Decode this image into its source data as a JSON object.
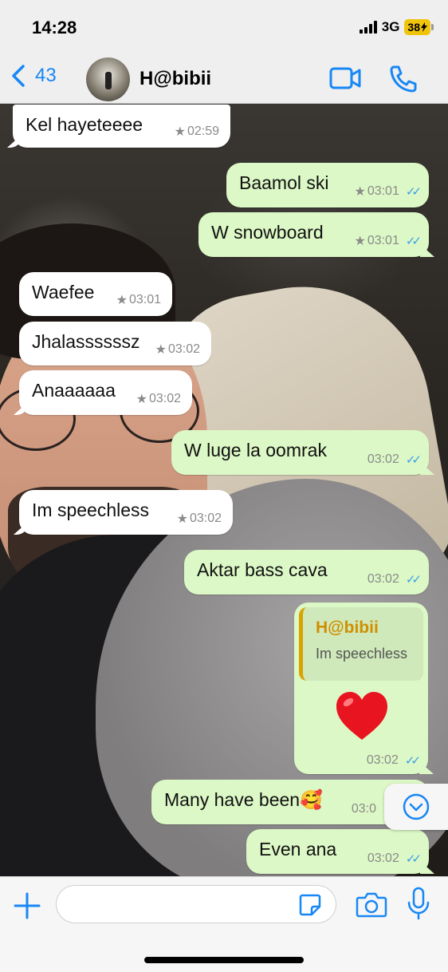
{
  "status_bar": {
    "time": "14:28",
    "network": "3G",
    "battery": "38"
  },
  "header": {
    "back_count": "43",
    "contact_name": "H@bibii",
    "icons": [
      "back-chevron-icon",
      "video-call-icon",
      "phone-call-icon"
    ]
  },
  "messages": [
    {
      "dir": "in",
      "text": "Kel hayeteeee",
      "time": "02:59",
      "starred": true
    },
    {
      "dir": "out",
      "text": "Baamol ski",
      "time": "03:01",
      "starred": true,
      "read": true
    },
    {
      "dir": "out",
      "text": "W snowboard",
      "time": "03:01",
      "starred": true,
      "read": true
    },
    {
      "dir": "in",
      "text": "Waefee",
      "time": "03:01",
      "starred": true
    },
    {
      "dir": "in",
      "text": "Jhalassssssz",
      "time": "03:02",
      "starred": true
    },
    {
      "dir": "in",
      "text": "Anaaaaaa",
      "time": "03:02",
      "starred": true
    },
    {
      "dir": "out",
      "text": "W luge la oomrak",
      "time": "03:02",
      "read": true
    },
    {
      "dir": "in",
      "text": "Im speechless",
      "time": "03:02",
      "starred": true
    },
    {
      "dir": "out",
      "text": "Aktar bass cava",
      "time": "03:02",
      "read": true
    },
    {
      "dir": "out",
      "type": "reply",
      "quote_name": "H@bibii",
      "quote_text": "Im speechless",
      "text": "❤️",
      "time": "03:02",
      "read": true
    },
    {
      "dir": "out",
      "text": "Many have been🥰",
      "time": "03:0",
      "read": true
    },
    {
      "dir": "out",
      "text": "Even ana",
      "time": "03:02",
      "read": true
    }
  ],
  "star_glyph": "★",
  "ticks_glyph": "✓✓",
  "input": {
    "placeholder": "",
    "value": ""
  },
  "colors": {
    "accent": "#1787f5",
    "outgoing_bubble": "#dcf8c6",
    "incoming_bubble": "#ffffff",
    "read_ticks": "#3a9ee8",
    "quote_bar": "#d8a300"
  }
}
